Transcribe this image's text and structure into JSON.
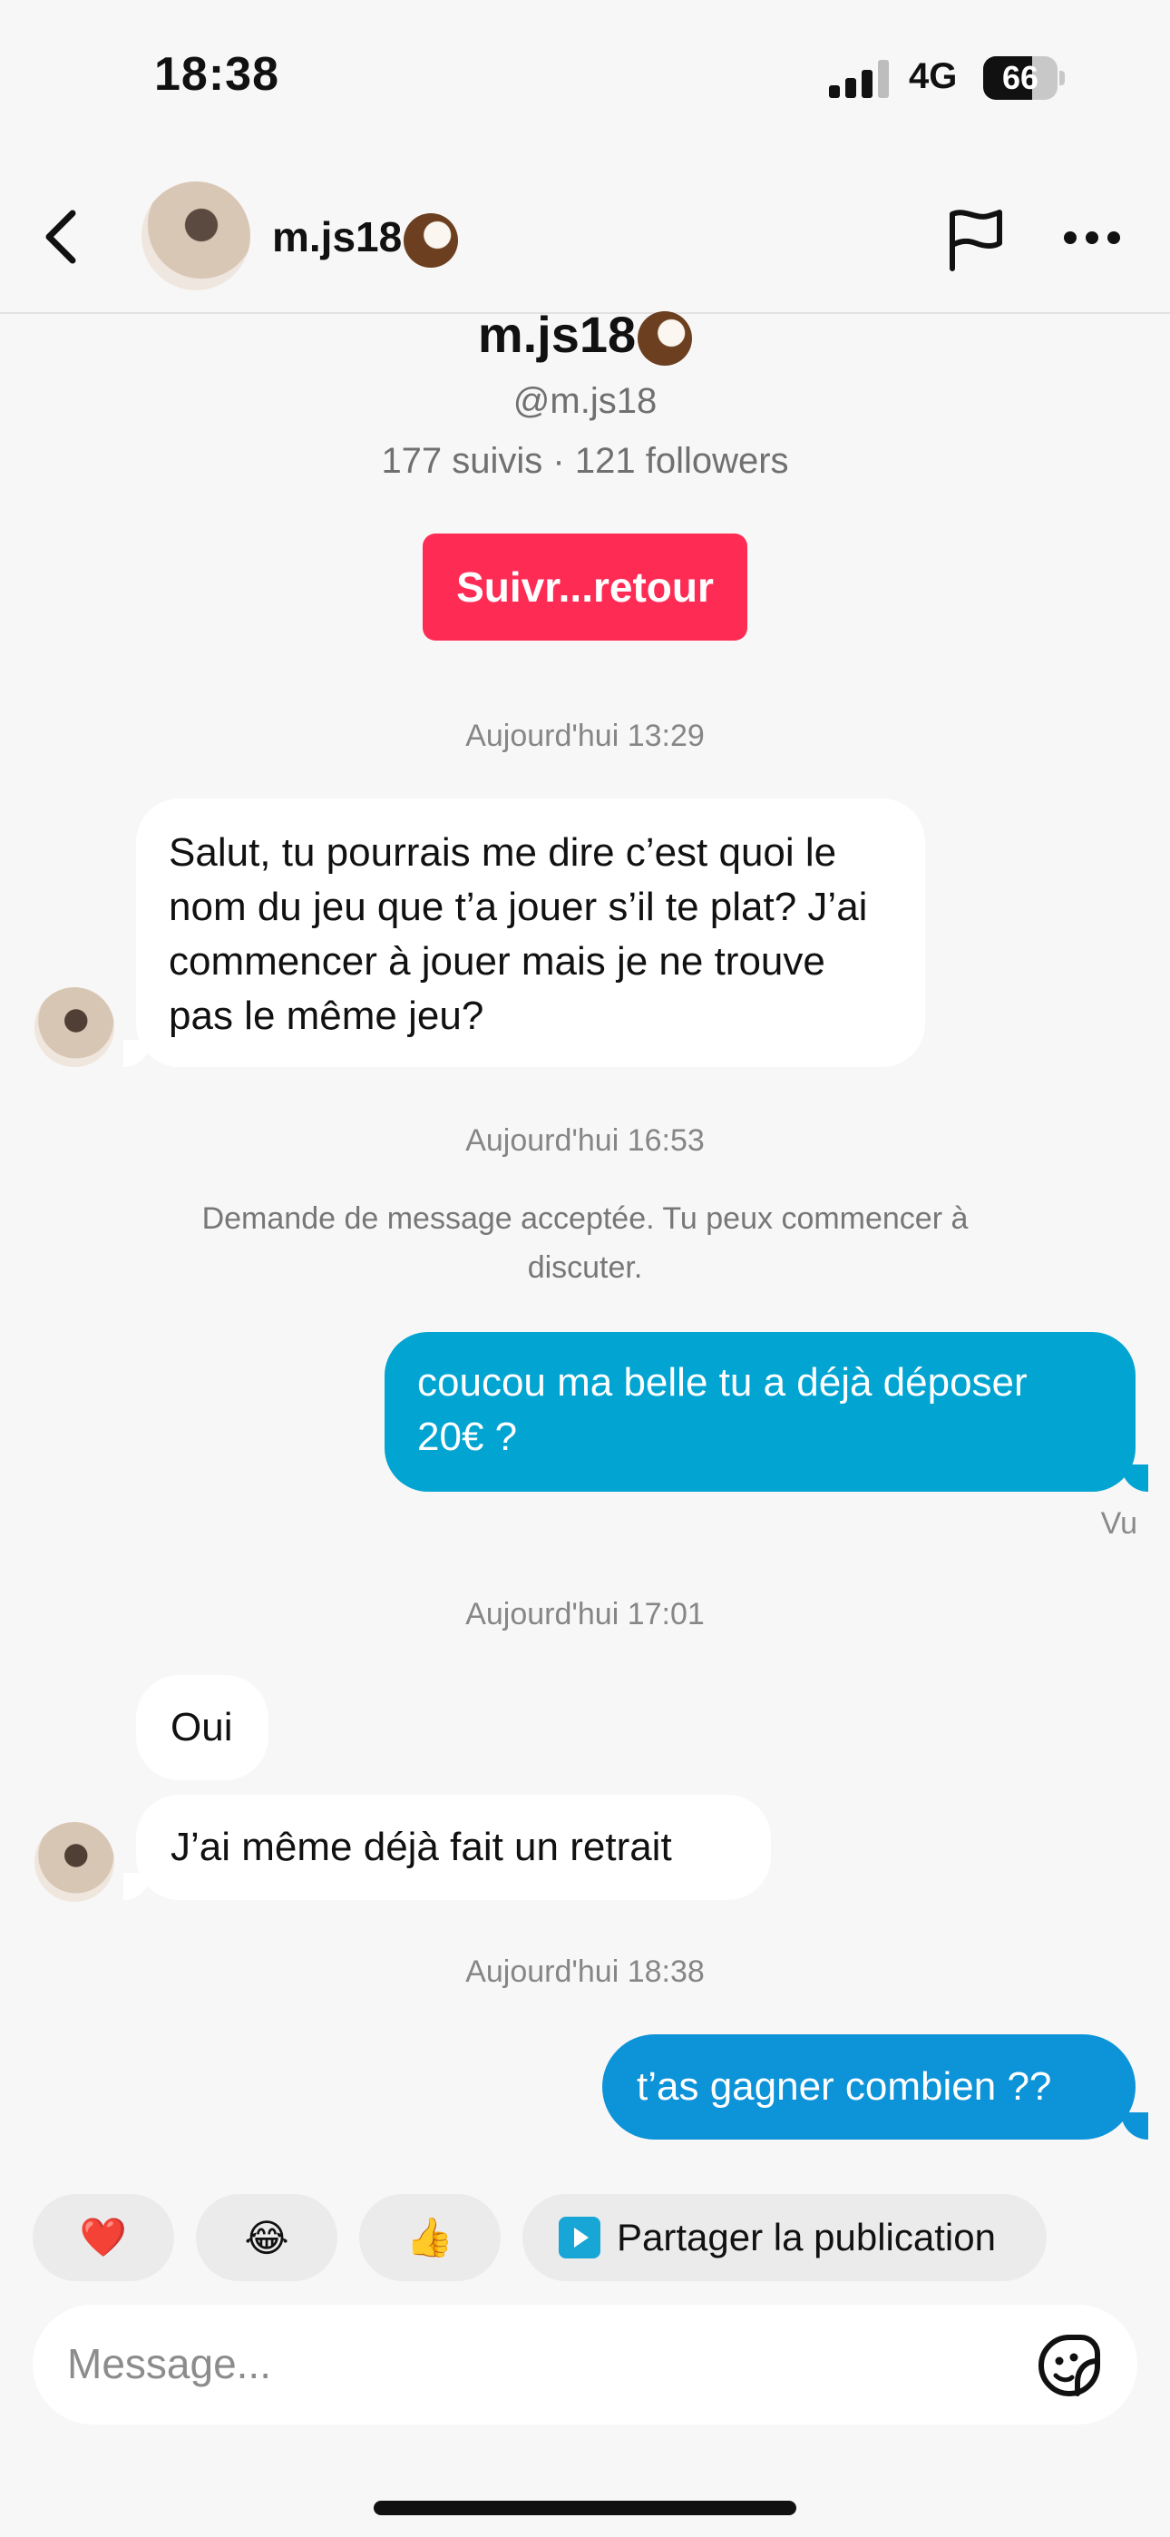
{
  "status_bar": {
    "time": "18:38",
    "network": "4G",
    "battery": "66",
    "battery_level": 0.66
  },
  "header": {
    "name": "m.js18",
    "icons": [
      "back-icon",
      "flag-icon",
      "more-icon"
    ]
  },
  "profile": {
    "name": "m.js18",
    "handle": "@m.js18",
    "stats": "177 suivis · 121 followers",
    "follow_button": "Suivr...retour"
  },
  "chat": {
    "stamp1": "Aujourd'hui 13:29",
    "msg1": "Salut, tu pourrais me dire c’est quoi le nom du jeu que t’a jouer s’il te plat? J’ai commencer à jouer mais je ne trouve pas le même jeu?",
    "stamp2": "Aujourd'hui 16:53",
    "system": "Demande de message acceptée. Tu peux commencer à discuter.",
    "msg2": "coucou ma belle tu a déjà déposer 20€ ?",
    "seen": "Vu",
    "stamp3": "Aujourd'hui 17:01",
    "msg3": "Oui",
    "msg4": "J’ai même déjà fait un retrait",
    "stamp4": "Aujourd'hui 18:38",
    "msg5": "t’as gagner combien ??"
  },
  "quick_replies": {
    "heart": "❤️",
    "laugh": "😂",
    "thumbs": "👍",
    "share": "Partager la publication"
  },
  "composer": {
    "placeholder": "Message..."
  },
  "colors": {
    "follow": "#fe2c55",
    "outgoing": "#02a4d2",
    "outgoing_last": "#0d93d8",
    "background": "#f7f7f7"
  }
}
